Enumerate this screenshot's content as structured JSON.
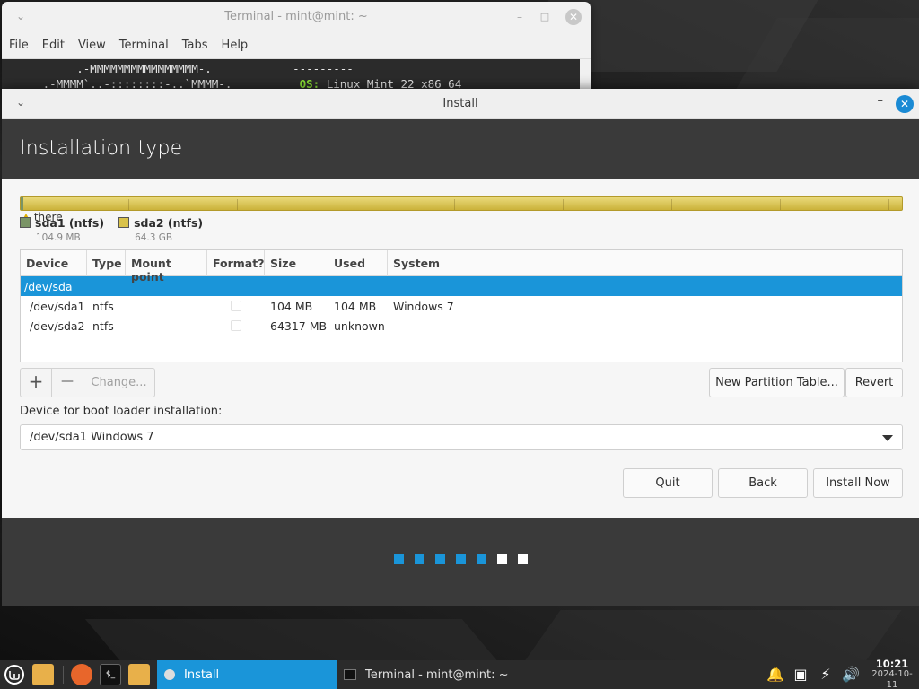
{
  "terminal": {
    "title": "Terminal - mint@mint: ~",
    "menu": [
      "File",
      "Edit",
      "View",
      "Terminal",
      "Tabs",
      "Help"
    ],
    "line1_art": "          .-MMMMMMMMMMMMMMMM-.            ---------",
    "line2_art": "     .-MMMM`..-::::::::-..`MMMM-.          ",
    "line2_key": "OS:",
    "line2_val": " Linux Mint 22 x86_64"
  },
  "installer": {
    "title": "Install",
    "heading": "Installation type",
    "warning_text": "there",
    "legend": [
      {
        "name": "sda1 (ntfs)",
        "size": "104.9 MB",
        "color": "#7a9466"
      },
      {
        "name": "sda2 (ntfs)",
        "size": "64.3 GB",
        "color": "#d9c24a"
      }
    ],
    "table": {
      "headers": [
        "Device",
        "Type",
        "Mount point",
        "Format?",
        "Size",
        "Used",
        "System"
      ],
      "rows": [
        {
          "device": "/dev/sda",
          "type": "",
          "mount": "",
          "size": "",
          "used": "",
          "system": "",
          "selected": true,
          "has_check": false
        },
        {
          "device": "/dev/sda1",
          "type": "ntfs",
          "mount": "",
          "size": "104 MB",
          "used": "104 MB",
          "system": "Windows 7",
          "selected": false,
          "has_check": true
        },
        {
          "device": "/dev/sda2",
          "type": "ntfs",
          "mount": "",
          "size": "64317 MB",
          "used": "unknown",
          "system": "",
          "selected": false,
          "has_check": true
        }
      ]
    },
    "buttons": {
      "add": "+",
      "remove": "—",
      "change": "Change...",
      "new_partition_table": "New Partition Table...",
      "revert": "Revert",
      "quit": "Quit",
      "back": "Back",
      "install_now": "Install Now"
    },
    "boot_loader": {
      "label": "Device for boot loader installation:",
      "value": "/dev/sda1 Windows 7"
    },
    "progress": {
      "completed": 5,
      "total": 7
    }
  },
  "taskbar": {
    "tasks": [
      {
        "label": "Install",
        "active": true
      },
      {
        "label": "Terminal - mint@mint: ~",
        "active": false
      }
    ],
    "clock": {
      "time": "10:21",
      "date": "2024-10-11"
    }
  },
  "colors": {
    "accent": "#1a95d9",
    "header_dark": "#3a3a3a",
    "partition_ntfs": "#d9c24a"
  }
}
